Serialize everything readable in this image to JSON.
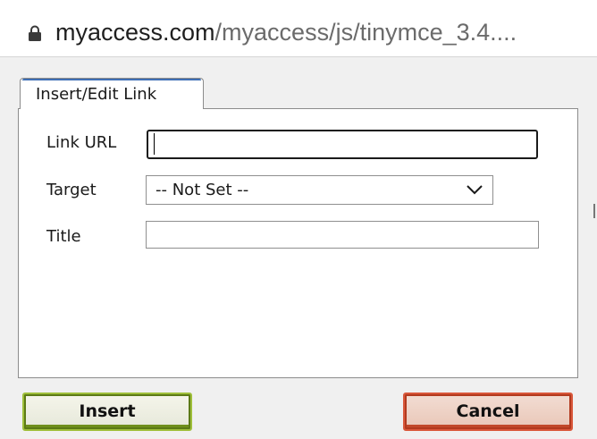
{
  "address_bar": {
    "host": "myaccess.com",
    "path": "/myaccess/js/tinymce_3.4...."
  },
  "dialog": {
    "tab_label": "Insert/Edit Link",
    "fields": {
      "link_url": {
        "label": "Link URL",
        "value": "",
        "placeholder": ""
      },
      "target": {
        "label": "Target",
        "selected": "-- Not Set --"
      },
      "title": {
        "label": "Title",
        "value": "",
        "placeholder": ""
      }
    },
    "buttons": {
      "insert": "Insert",
      "cancel": "Cancel"
    }
  },
  "icons": {
    "lock": "lock-icon",
    "dropdown": "chevron-down-icon"
  },
  "colors": {
    "insert_border": "#9fbf3a",
    "cancel_border": "#d9573a",
    "tab_accent": "#3e6fb5"
  }
}
